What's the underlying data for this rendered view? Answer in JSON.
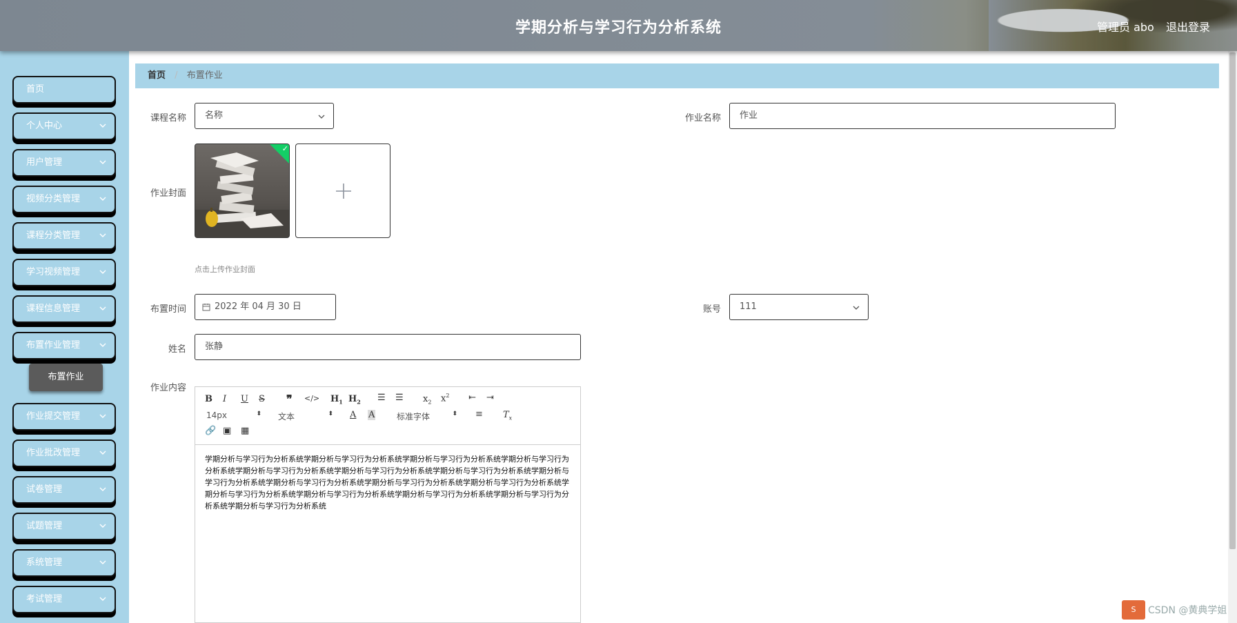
{
  "header": {
    "title": "学期分析与学习行为分析系统",
    "user": "管理员 abo",
    "logout": "退出登录"
  },
  "sidebar": {
    "items": [
      {
        "label": "首页",
        "expandable": false
      },
      {
        "label": "个人中心",
        "expandable": true
      },
      {
        "label": "用户管理",
        "expandable": true
      },
      {
        "label": "视频分类管理",
        "expandable": true
      },
      {
        "label": "课程分类管理",
        "expandable": true
      },
      {
        "label": "学习视频管理",
        "expandable": true
      },
      {
        "label": "课程信息管理",
        "expandable": true
      },
      {
        "label": "布置作业管理",
        "expandable": true,
        "expanded": true
      },
      {
        "label": "作业提交管理",
        "expandable": true
      },
      {
        "label": "作业批改管理",
        "expandable": true
      },
      {
        "label": "试卷管理",
        "expandable": true
      },
      {
        "label": "试题管理",
        "expandable": true
      },
      {
        "label": "系统管理",
        "expandable": true
      },
      {
        "label": "考试管理",
        "expandable": true
      }
    ],
    "sub_item": "布置作业"
  },
  "breadcrumb": {
    "home": "首页",
    "separator": "/",
    "current": "布置作业"
  },
  "form": {
    "course_name_label": "课程名称",
    "course_name_value": "名称",
    "homework_name_label": "作业名称",
    "homework_name_value": "作业",
    "cover_label": "作业封面",
    "cover_tip": "点击上传作业封面",
    "time_label": "布置时间",
    "time_value": "2022 年 04 月 30 日",
    "account_label": "账号",
    "account_value": "111",
    "name_label": "姓名",
    "name_value": "张静",
    "content_label": "作业内容"
  },
  "editor": {
    "font_size": "14px",
    "text_type": "文本",
    "font_family": "标准字体",
    "content": "学期分析与学习行为分析系统学期分析与学习行为分析系统学期分析与学习行为分析系统学期分析与学习行为分析系统学期分析与学习行为分析系统学期分析与学习行为分析系统学期分析与学习行为分析系统学期分析与学习行为分析系统学期分析与学习行为分析系统学期分析与学习行为分析系统学期分析与学习行为分析系统学期分析与学习行为分析系统学期分析与学习行为分析系统学期分析与学习行为分析系统学期分析与学习行为分析系统学期分析与学习行为分析系统"
  },
  "watermark": "CSDN @黄典学姐",
  "colors": {
    "sidebar_bg": "#a8d4e8",
    "header_bg": "#848d96",
    "active_sub": "#5b5b5b",
    "check_green": "#13ce66"
  }
}
